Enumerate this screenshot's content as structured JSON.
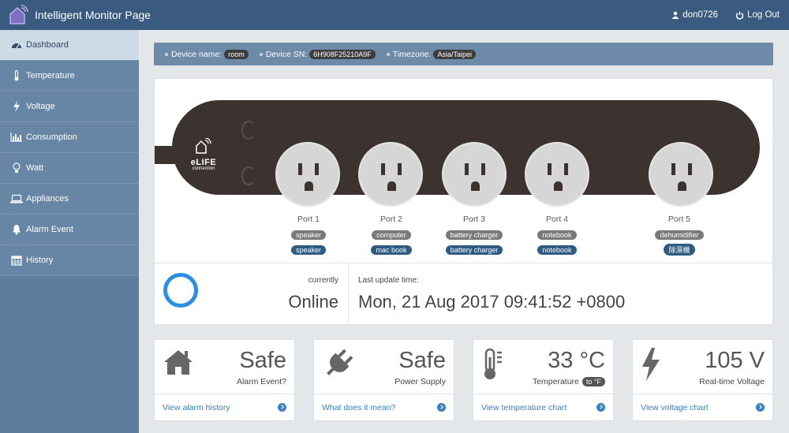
{
  "header": {
    "title": "Intelligent Monitor Page",
    "user": "don0726",
    "logout": "Log Out"
  },
  "sidebar": {
    "items": [
      {
        "label": "Dashboard",
        "icon": "dashboard-icon"
      },
      {
        "label": "Temperature",
        "icon": "thermometer-icon"
      },
      {
        "label": "Voltage",
        "icon": "bolt-icon"
      },
      {
        "label": "Consumption",
        "icon": "bar-chart-icon"
      },
      {
        "label": "Watt",
        "icon": "lightbulb-icon"
      },
      {
        "label": "Appliances",
        "icon": "laptop-icon"
      },
      {
        "label": "Alarm Event",
        "icon": "bell-icon"
      },
      {
        "label": "History",
        "icon": "calendar-icon"
      }
    ]
  },
  "device": {
    "name_label": "Device name:",
    "name": "room",
    "sn_label": "Device SN:",
    "sn": "6H908F25210A9F",
    "tz_label": "Timezone:",
    "tz": "Asia/Taipei",
    "brand": "eLIFE",
    "brand_sub": "connection"
  },
  "ports": [
    {
      "name": "Port 1",
      "tag1": "speaker",
      "tag2": "speaker"
    },
    {
      "name": "Port 2",
      "tag1": "computer",
      "tag2": "mac book"
    },
    {
      "name": "Port 3",
      "tag1": "battery charger",
      "tag2": "battery charger"
    },
    {
      "name": "Port 4",
      "tag1": "notebook",
      "tag2": "notebook"
    },
    {
      "name": "Port 5",
      "tag1": "dehumidifier",
      "tag2": "除濕機"
    }
  ],
  "status": {
    "currently": "currently",
    "state": "Online",
    "last_label": "Last update time:",
    "last_time": "Mon, 21 Aug 2017 09:41:52 +0800"
  },
  "cards": [
    {
      "value": "Safe",
      "label": "Alarm Event?",
      "link": "View alarm history",
      "icon": "home-icon"
    },
    {
      "value": "Safe",
      "label": "Power Supply",
      "link": "What does it mean?",
      "icon": "plug-icon"
    },
    {
      "value": "33 °C",
      "label": "Temperature",
      "toggle": "to °F",
      "link": "View temperature chart",
      "icon": "thermometer-icon"
    },
    {
      "value": "105 V",
      "label": "Real-time Voltage",
      "link": "View voltage chart",
      "icon": "bolt-icon"
    }
  ],
  "colors": {
    "header": "#3a5a80",
    "sidebar": "#6786a6",
    "accent": "#2b8ee3",
    "strip": "#3c3331"
  }
}
